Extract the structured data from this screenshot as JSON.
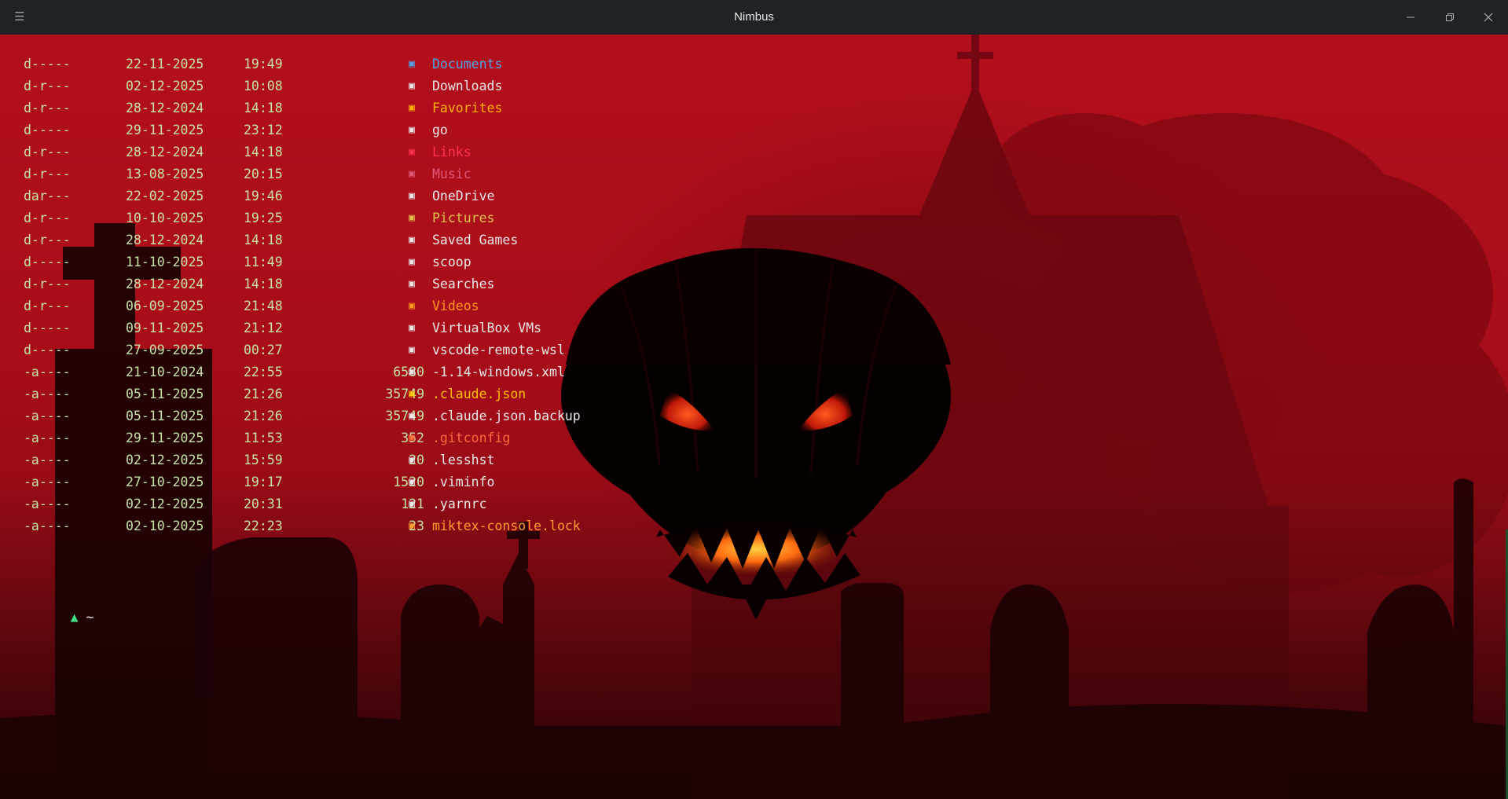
{
  "window": {
    "title": "Nimbus",
    "menu_glyph": "☰",
    "controls": {
      "minimize": "minimize-icon",
      "maximize": "restore-icon",
      "close": "close-icon"
    }
  },
  "colors": {
    "default_text": "#c6e3a5",
    "folder_documents": "#4fa3e8",
    "folder_plain": "#e8e8e8",
    "folder_favorites": "#ffb300",
    "folder_links": "#ff3355",
    "folder_music": "#e05a7a",
    "folder_pictures": "#e0c44a",
    "folder_videos": "#ff9a1f",
    "file_json": "#ffc107",
    "file_gitconfig": "#ff6a3d",
    "file_lock": "#ff9d2e",
    "prompt_arrow": "#3ddc84"
  },
  "listing": {
    "entries": [
      {
        "mode": "d-----",
        "date": "22-11-2025",
        "time": "19:49",
        "size": "",
        "icon": "folder-icon",
        "name": "Documents",
        "color": "#4fa3e8"
      },
      {
        "mode": "d-r---",
        "date": "02-12-2025",
        "time": "10:08",
        "size": "",
        "icon": "folder-icon",
        "name": "Downloads",
        "color": "#e8e8e8"
      },
      {
        "mode": "d-r---",
        "date": "28-12-2024",
        "time": "14:18",
        "size": "",
        "icon": "folder-icon",
        "name": "Favorites",
        "color": "#ffb300"
      },
      {
        "mode": "d-----",
        "date": "29-11-2025",
        "time": "23:12",
        "size": "",
        "icon": "folder-icon",
        "name": "go",
        "color": "#e8e8e8"
      },
      {
        "mode": "d-r---",
        "date": "28-12-2024",
        "time": "14:18",
        "size": "",
        "icon": "folder-icon",
        "name": "Links",
        "color": "#ff3355"
      },
      {
        "mode": "d-r---",
        "date": "13-08-2025",
        "time": "20:15",
        "size": "",
        "icon": "folder-icon",
        "name": "Music",
        "color": "#e05a7a"
      },
      {
        "mode": "dar---",
        "date": "22-02-2025",
        "time": "19:46",
        "size": "",
        "icon": "folder-icon",
        "name": "OneDrive",
        "color": "#e8e8e8"
      },
      {
        "mode": "d-r---",
        "date": "10-10-2025",
        "time": "19:25",
        "size": "",
        "icon": "folder-icon",
        "name": "Pictures",
        "color": "#e0c44a"
      },
      {
        "mode": "d-r---",
        "date": "28-12-2024",
        "time": "14:18",
        "size": "",
        "icon": "folder-icon",
        "name": "Saved Games",
        "color": "#e8e8e8"
      },
      {
        "mode": "d-----",
        "date": "11-10-2025",
        "time": "11:49",
        "size": "",
        "icon": "folder-icon",
        "name": "scoop",
        "color": "#e8e8e8"
      },
      {
        "mode": "d-r---",
        "date": "28-12-2024",
        "time": "14:18",
        "size": "",
        "icon": "folder-icon",
        "name": "Searches",
        "color": "#e8e8e8"
      },
      {
        "mode": "d-r---",
        "date": "06-09-2025",
        "time": "21:48",
        "size": "",
        "icon": "folder-icon",
        "name": "Videos",
        "color": "#ff9a1f"
      },
      {
        "mode": "d-----",
        "date": "09-11-2025",
        "time": "21:12",
        "size": "",
        "icon": "folder-icon",
        "name": "VirtualBox VMs",
        "color": "#e8e8e8"
      },
      {
        "mode": "d-----",
        "date": "27-09-2025",
        "time": "00:27",
        "size": "",
        "icon": "folder-icon",
        "name": "vscode-remote-wsl",
        "color": "#e8e8e8"
      },
      {
        "mode": "-a----",
        "date": "21-10-2024",
        "time": "22:55",
        "size": "6580",
        "icon": "file-icon",
        "name": "-1.14-windows.xml",
        "color": "#e8e8e8"
      },
      {
        "mode": "-a----",
        "date": "05-11-2025",
        "time": "21:26",
        "size": "35749",
        "icon": "json-file-icon",
        "name": ".claude.json",
        "color": "#ffc107"
      },
      {
        "mode": "-a----",
        "date": "05-11-2025",
        "time": "21:26",
        "size": "35749",
        "icon": "file-icon",
        "name": ".claude.json.backup",
        "color": "#e8e8e8"
      },
      {
        "mode": "-a----",
        "date": "29-11-2025",
        "time": "11:53",
        "size": "352",
        "icon": "git-file-icon",
        "name": ".gitconfig",
        "color": "#ff6a3d"
      },
      {
        "mode": "-a----",
        "date": "02-12-2025",
        "time": "15:59",
        "size": "20",
        "icon": "file-icon",
        "name": ".lesshst",
        "color": "#e8e8e8"
      },
      {
        "mode": "-a----",
        "date": "27-10-2025",
        "time": "19:17",
        "size": "1520",
        "icon": "file-icon",
        "name": ".viminfo",
        "color": "#e8e8e8"
      },
      {
        "mode": "-a----",
        "date": "02-12-2025",
        "time": "20:31",
        "size": "121",
        "icon": "file-icon",
        "name": ".yarnrc",
        "color": "#e8e8e8"
      },
      {
        "mode": "-a----",
        "date": "02-10-2025",
        "time": "22:23",
        "size": "23",
        "icon": "lock-file-icon",
        "name": "miktex-console.lock",
        "color": "#ff9d2e"
      }
    ]
  },
  "prompt": {
    "arrow": "▲",
    "directory": "~"
  }
}
